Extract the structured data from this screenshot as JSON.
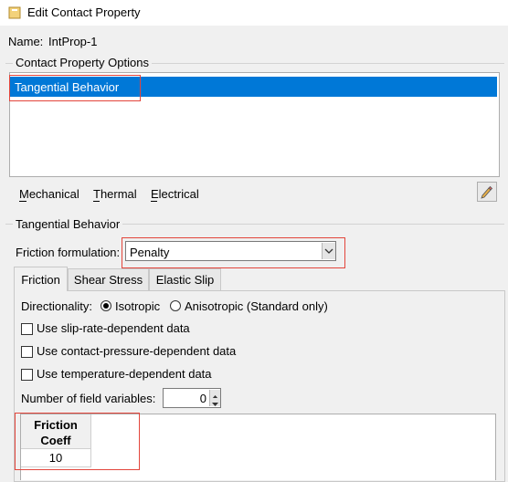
{
  "window": {
    "title": "Edit Contact Property"
  },
  "name": {
    "label": "Name:",
    "value": "IntProp-1"
  },
  "options": {
    "group_title": "Contact Property Options",
    "items": [
      "Tangential Behavior"
    ],
    "selected_color": "#0078d7"
  },
  "menu": {
    "items": [
      "Mechanical",
      "Thermal",
      "Electrical"
    ]
  },
  "tangential": {
    "group_title": "Tangential Behavior",
    "friction_label": "Friction formulation:",
    "friction_value": "Penalty"
  },
  "tabs": [
    {
      "label": "Friction",
      "active": true
    },
    {
      "label": "Shear Stress",
      "active": false
    },
    {
      "label": "Elastic Slip",
      "active": false
    }
  ],
  "friction": {
    "directionality_label": "Directionality:",
    "radio_isotropic": "Isotropic",
    "radio_anisotropic": "Anisotropic (Standard only)",
    "selected_radio": "Isotropic",
    "check_slip_rate": "Use slip-rate-dependent data",
    "check_contact_pressure": "Use contact-pressure-dependent data",
    "check_temperature": "Use temperature-dependent data",
    "field_vars_label": "Number of field variables:",
    "field_vars_value": "0",
    "table": {
      "header_line1": "Friction",
      "header_line2": "Coeff",
      "rows": [
        "10"
      ]
    }
  },
  "highlight_color": "#e3453b"
}
